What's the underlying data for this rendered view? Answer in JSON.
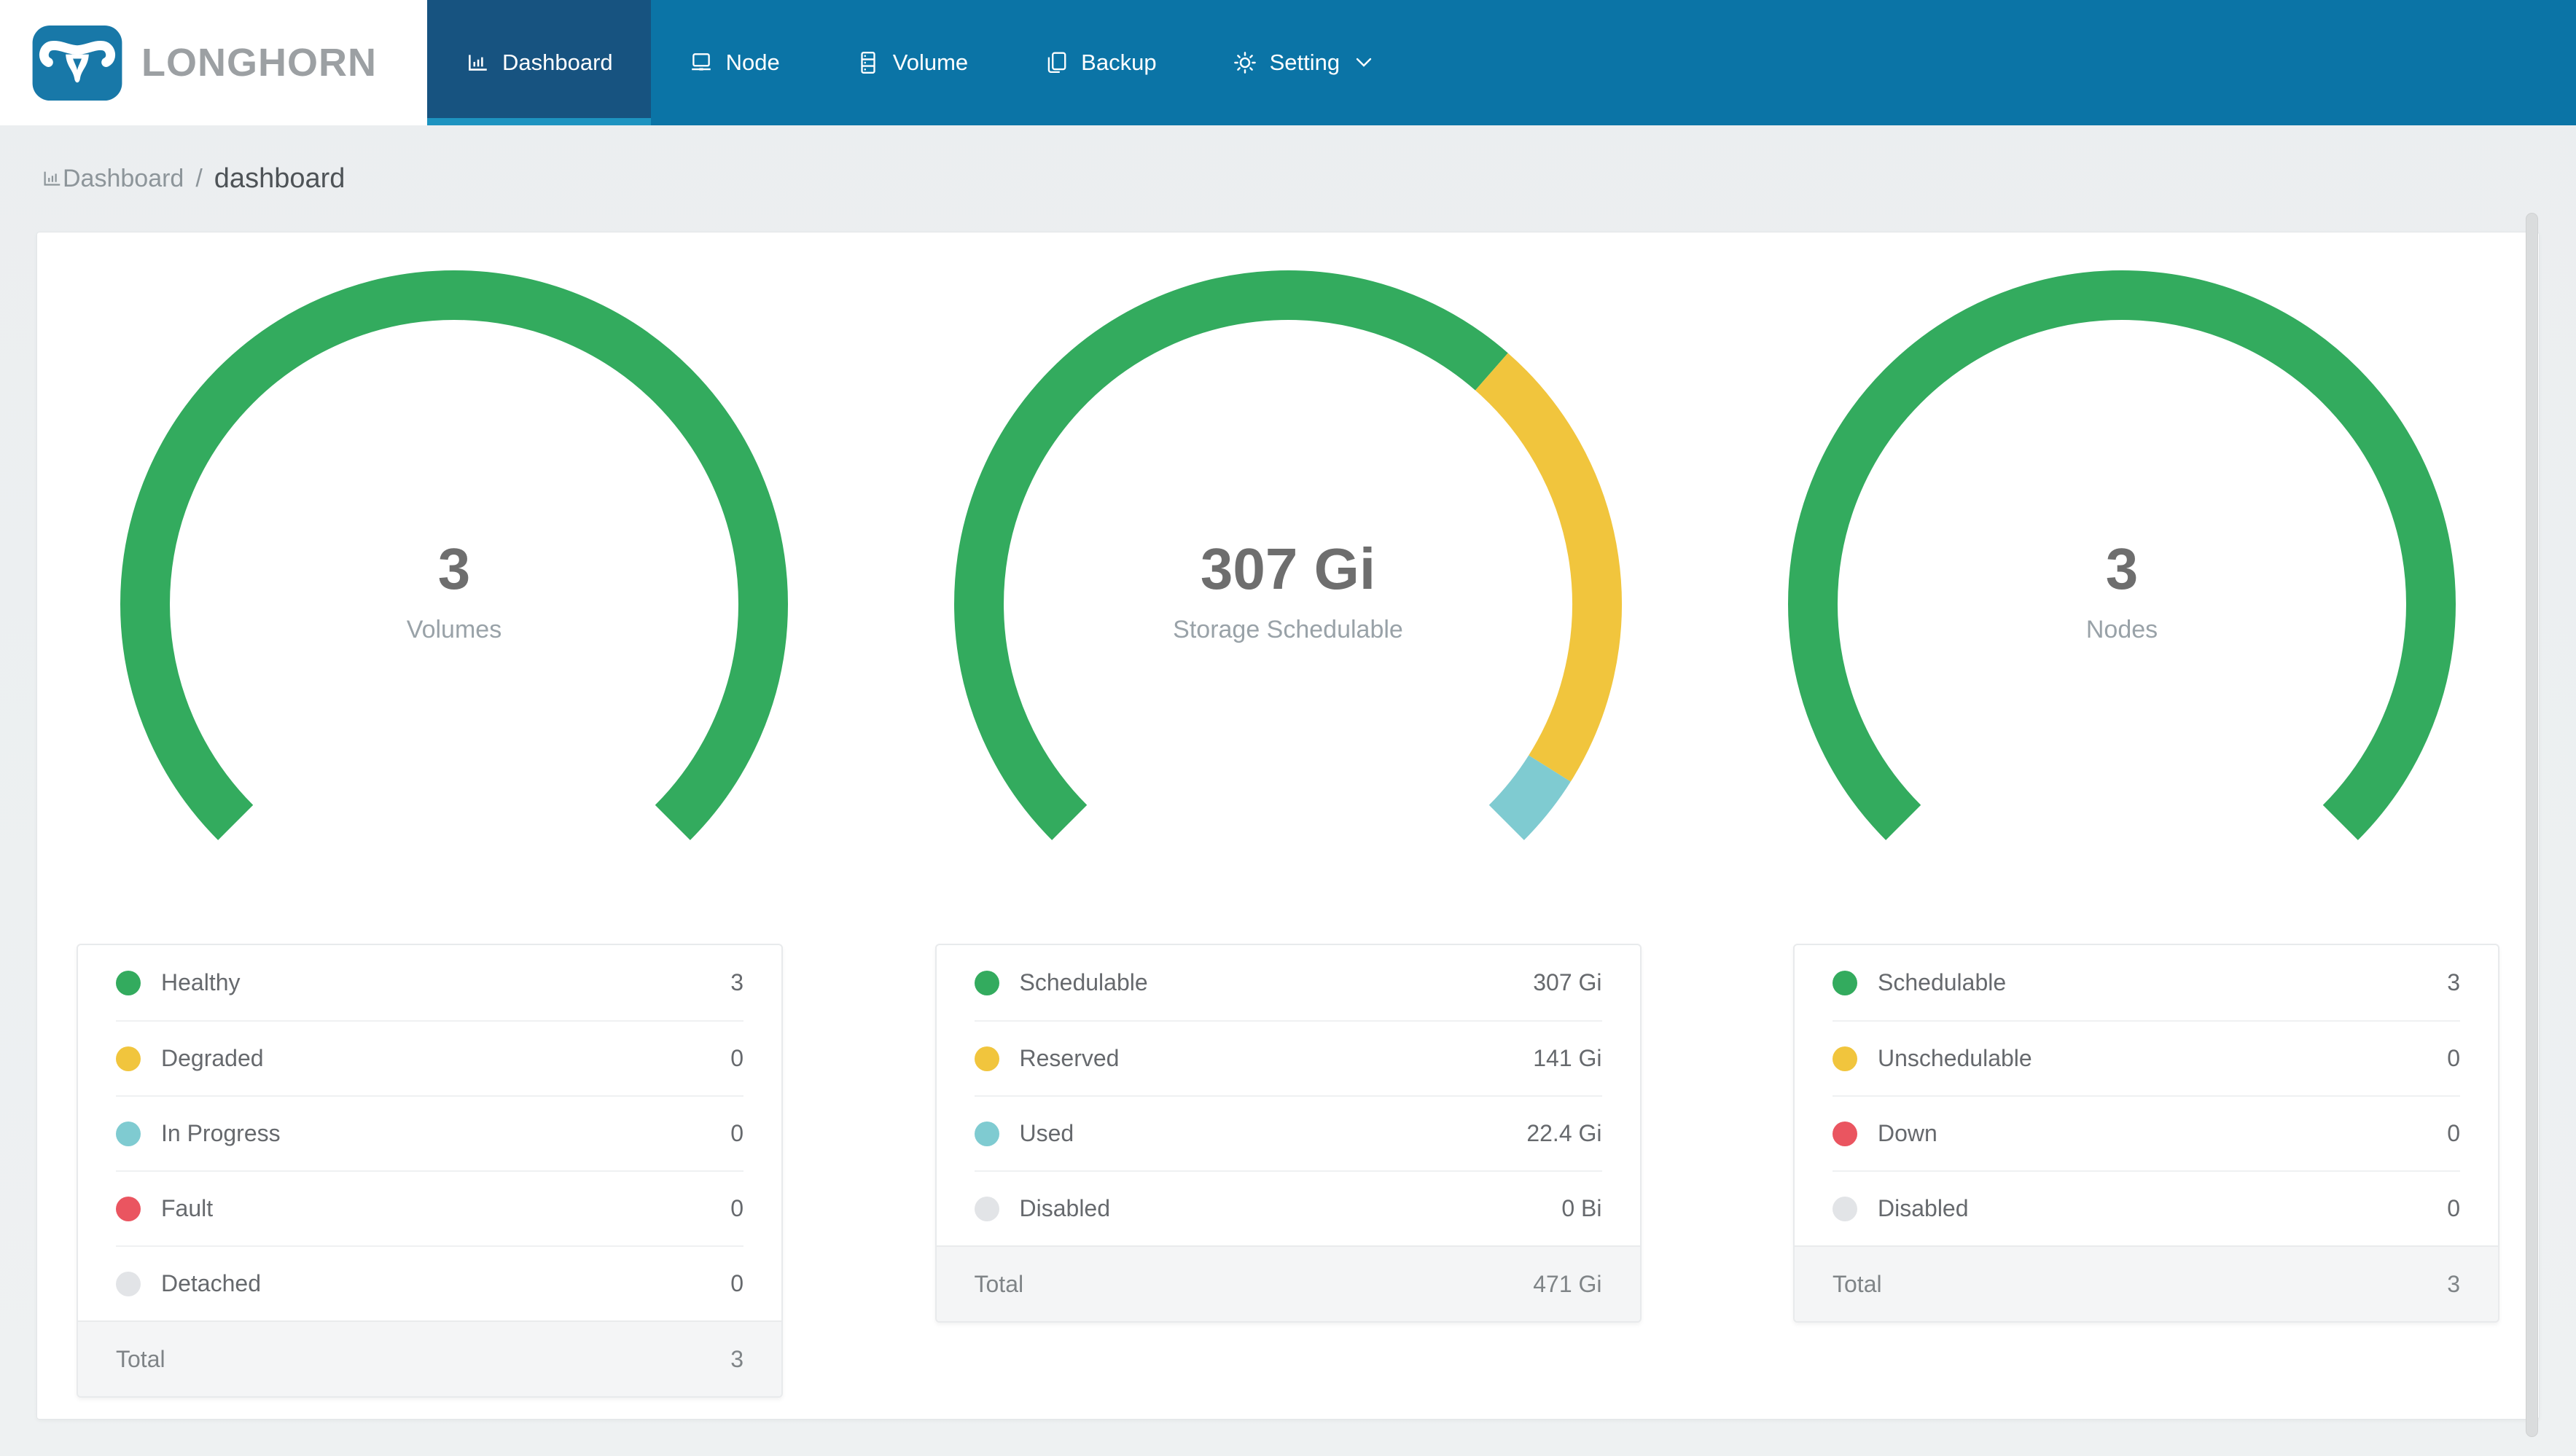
{
  "brand": {
    "name": "LONGHORN",
    "logo_icon": "longhorn-bull-icon"
  },
  "colors": {
    "navbar_bg": "#0b74a6",
    "navbar_active_bg": "#175380",
    "navbar_active_strip": "#1d93c0",
    "logo_blue": "#1878a8",
    "green": "#33ab5e",
    "yellow": "#f1c53d",
    "teal": "#7fcbd1",
    "red": "#ea5560",
    "gray": "#e2e4e7"
  },
  "navbar": {
    "items": [
      {
        "label": "Dashboard",
        "icon": "bar-chart-icon",
        "active": true
      },
      {
        "label": "Node",
        "icon": "laptop-icon",
        "active": false
      },
      {
        "label": "Volume",
        "icon": "server-icon",
        "active": false
      },
      {
        "label": "Backup",
        "icon": "copy-icon",
        "active": false
      },
      {
        "label": "Setting",
        "icon": "gear-icon",
        "has_dropdown": true,
        "active": false
      }
    ]
  },
  "breadcrumb": {
    "icon": "bar-chart-icon",
    "root": "Dashboard",
    "separator": "/",
    "current": "dashboard"
  },
  "chart_data": [
    {
      "type": "gauge-donut",
      "title": "Volumes",
      "center_value": "3",
      "center_label": "Volumes",
      "start_angle": 225,
      "sweep": 270,
      "segments": [
        {
          "label": "Healthy",
          "value": 3,
          "display": "3",
          "color_key": "green"
        },
        {
          "label": "Degraded",
          "value": 0,
          "display": "0",
          "color_key": "yellow"
        },
        {
          "label": "In Progress",
          "value": 0,
          "display": "0",
          "color_key": "teal"
        },
        {
          "label": "Fault",
          "value": 0,
          "display": "0",
          "color_key": "red"
        },
        {
          "label": "Detached",
          "value": 0,
          "display": "0",
          "color_key": "gray"
        }
      ],
      "total": {
        "label": "Total",
        "display": "3"
      }
    },
    {
      "type": "gauge-donut",
      "title": "Storage Schedulable",
      "center_value": "307 Gi",
      "center_label": "Storage Schedulable",
      "start_angle": 225,
      "sweep": 270,
      "segments": [
        {
          "label": "Schedulable",
          "value": 307,
          "display": "307 Gi",
          "color_key": "green"
        },
        {
          "label": "Reserved",
          "value": 141,
          "display": "141 Gi",
          "color_key": "yellow"
        },
        {
          "label": "Used",
          "value": 22.4,
          "display": "22.4 Gi",
          "color_key": "teal"
        },
        {
          "label": "Disabled",
          "value": 0,
          "display": "0 Bi",
          "color_key": "gray"
        }
      ],
      "total": {
        "label": "Total",
        "display": "471 Gi"
      }
    },
    {
      "type": "gauge-donut",
      "title": "Nodes",
      "center_value": "3",
      "center_label": "Nodes",
      "start_angle": 225,
      "sweep": 270,
      "segments": [
        {
          "label": "Schedulable",
          "value": 3,
          "display": "3",
          "color_key": "green"
        },
        {
          "label": "Unschedulable",
          "value": 0,
          "display": "0",
          "color_key": "yellow"
        },
        {
          "label": "Down",
          "value": 0,
          "display": "0",
          "color_key": "red"
        },
        {
          "label": "Disabled",
          "value": 0,
          "display": "0",
          "color_key": "gray"
        }
      ],
      "total": {
        "label": "Total",
        "display": "3"
      }
    }
  ]
}
